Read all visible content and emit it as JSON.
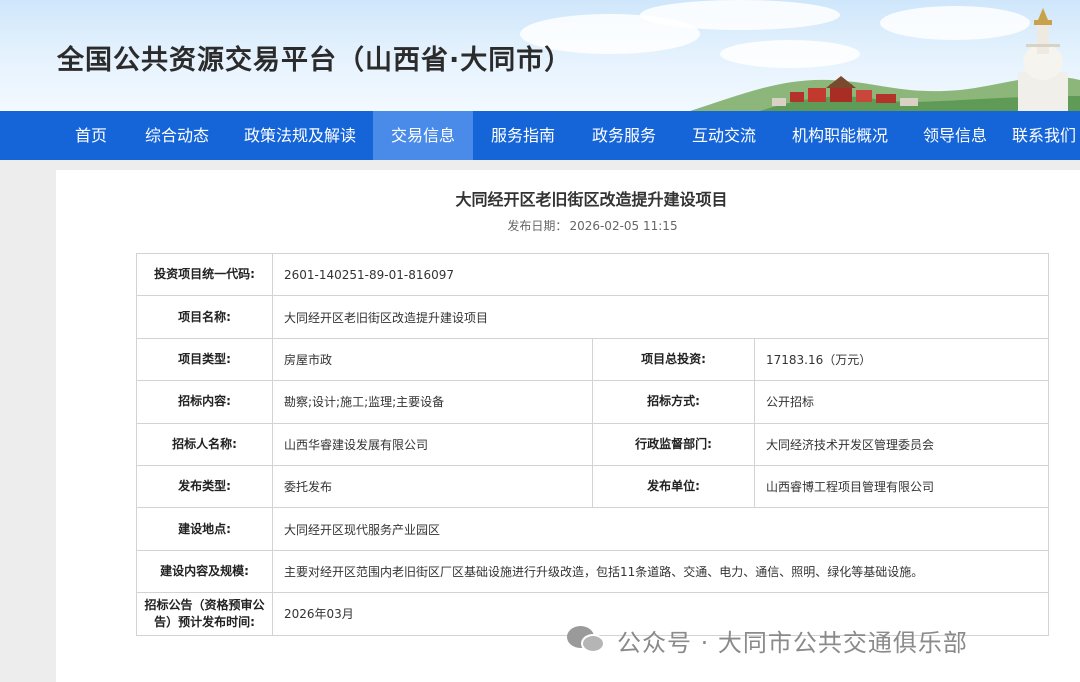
{
  "site": {
    "title": "全国公共资源交易平台（山西省·大同市）"
  },
  "nav": [
    {
      "label": "首页"
    },
    {
      "label": "综合动态"
    },
    {
      "label": "政策法规及解读"
    },
    {
      "label": "交易信息",
      "active": true
    },
    {
      "label": "服务指南"
    },
    {
      "label": "政务服务"
    },
    {
      "label": "互动交流"
    },
    {
      "label": "机构职能概况"
    },
    {
      "label": "领导信息"
    },
    {
      "label": "联系我们"
    }
  ],
  "article": {
    "title": "大同经开区老旧街区改造提升建设项目",
    "date_label": "发布日期：",
    "date_value": "2026-02-05 11:15"
  },
  "details": {
    "code_label": "投资项目统一代码:",
    "code_value": "2601-140251-89-01-816097",
    "name_label": "项目名称:",
    "name_value": "大同经开区老旧街区改造提升建设项目",
    "type_label": "项目类型:",
    "type_value": "房屋市政",
    "invest_label": "项目总投资:",
    "invest_value": "17183.16（万元）",
    "content_label": "招标内容:",
    "content_value": "勘察;设计;施工;监理;主要设备",
    "method_label": "招标方式:",
    "method_value": "公开招标",
    "tenderer_label": "招标人名称:",
    "tenderer_value": "山西华睿建设发展有限公司",
    "supervisor_label": "行政监督部门:",
    "supervisor_value": "大同经济技术开发区管理委员会",
    "pubtype_label": "发布类型:",
    "pubtype_value": "委托发布",
    "publisher_label": "发布单位:",
    "publisher_value": "山西睿博工程项目管理有限公司",
    "location_label": "建设地点:",
    "location_value": "大同经开区现代服务产业园区",
    "scope_label": "建设内容及规模:",
    "scope_value": "主要对经开区范围内老旧街区厂区基础设施进行升级改造，包括11条道路、交通、电力、通信、照明、绿化等基础设施。",
    "notice_label": "招标公告（资格预审公告）预计发布时间:",
    "notice_value": "2026年03月"
  },
  "watermark": {
    "text": "公众号 · 大同市公共交通俱乐部"
  },
  "colors": {
    "nav_bg": "#1565d8",
    "nav_active": "#4a8bea",
    "border": "#d3d3d3"
  }
}
